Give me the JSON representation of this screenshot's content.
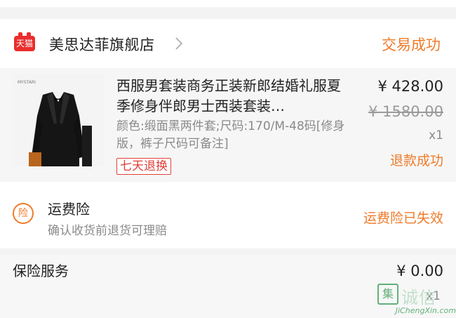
{
  "shop": {
    "badge_label": "天猫",
    "name": "美思达菲旗舰店",
    "trade_status": "交易成功"
  },
  "product": {
    "title": "西服男套装商务正装新郎结婚礼服夏季修身伴郎男士西装套装…",
    "spec": "颜色:缎面黑两件套;尺码:170/M-48码[修身版，裤子尺码可备注]",
    "return_tag": "七天退换",
    "price_now": "¥ 428.00",
    "price_original": "¥ 1580.00",
    "quantity": "x1",
    "refund_status": "退款成功",
    "thumb_brand": "MYSTARI"
  },
  "shipping_insurance": {
    "icon_glyph": "险",
    "title": "运费险",
    "description": "确认收货前退货可理赔",
    "status": "运费险已失效"
  },
  "insurance_service": {
    "title": "保险服务",
    "price": "¥ 0.00",
    "quantity": "x1"
  },
  "watermark": {
    "box_glyph": "集",
    "text": "诚信",
    "site": "JiChengXin.com"
  },
  "colors": {
    "accent_orange": "#ef7b2a",
    "tmall_red": "#ea2d2d",
    "tag_red": "#e2403b",
    "watermark_green": "#4aa466"
  }
}
